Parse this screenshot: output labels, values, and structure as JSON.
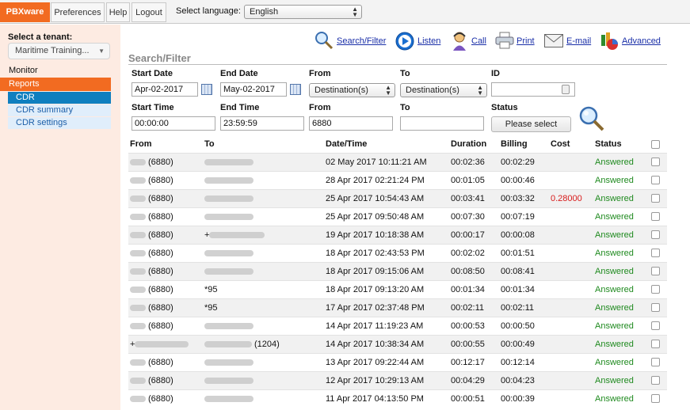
{
  "nav": {
    "logo": "PBXware",
    "preferences": "Preferences",
    "help": "Help",
    "logout": "Logout",
    "language_label": "Select language:",
    "language_value": "English"
  },
  "sidebar": {
    "tenant_label": "Select a tenant:",
    "tenant_value": "Maritime Training...",
    "monitor": "Monitor",
    "reports": "Reports",
    "items": [
      "CDR",
      "CDR summary",
      "CDR settings"
    ]
  },
  "toolbar": {
    "search_filter": "Search/Filter",
    "listen": "Listen",
    "call": "Call",
    "print": "Print",
    "email": "E-mail",
    "advanced": "Advanced"
  },
  "filter": {
    "title": "Search/Filter",
    "start_date_label": "Start Date",
    "start_date": "Apr-02-2017",
    "end_date_label": "End Date",
    "end_date": "May-02-2017",
    "from_label": "From",
    "from_select": "Destination(s)",
    "to_label": "To",
    "to_select": "Destination(s)",
    "id_label": "ID",
    "id_value": "",
    "start_time_label": "Start Time",
    "start_time": "00:00:00",
    "end_time_label": "End Time",
    "end_time": "23:59:59",
    "from2_label": "From",
    "from2_value": "6880",
    "to2_label": "To",
    "to2_value": "",
    "status_label": "Status",
    "status_button": "Please select"
  },
  "table": {
    "headers": [
      "From",
      "To",
      "Date/Time",
      "Duration",
      "Billing",
      "Cost",
      "Status"
    ],
    "rows": [
      {
        "from": "(6880)",
        "to": "",
        "dt": "02 May 2017 10:11:21 AM",
        "dur": "00:02:36",
        "bill": "00:02:29",
        "cost": "",
        "status": "Answered"
      },
      {
        "from": "(6880)",
        "to": "",
        "dt": "28 Apr 2017 02:21:24 PM",
        "dur": "00:01:05",
        "bill": "00:00:46",
        "cost": "",
        "status": "Answered"
      },
      {
        "from": "(6880)",
        "to": "",
        "dt": "25 Apr 2017 10:54:43 AM",
        "dur": "00:03:41",
        "bill": "00:03:32",
        "cost": "0.28000",
        "status": "Answered"
      },
      {
        "from": "(6880)",
        "to": "",
        "dt": "25 Apr 2017 09:50:48 AM",
        "dur": "00:07:30",
        "bill": "00:07:19",
        "cost": "",
        "status": "Answered"
      },
      {
        "from": "(6880)",
        "to": "+",
        "dt": "19 Apr 2017 10:18:38 AM",
        "dur": "00:00:17",
        "bill": "00:00:08",
        "cost": "",
        "status": "Answered"
      },
      {
        "from": "(6880)",
        "to": "",
        "dt": "18 Apr 2017 02:43:53 PM",
        "dur": "00:02:02",
        "bill": "00:01:51",
        "cost": "",
        "status": "Answered"
      },
      {
        "from": "(6880)",
        "to": "",
        "dt": "18 Apr 2017 09:15:06 AM",
        "dur": "00:08:50",
        "bill": "00:08:41",
        "cost": "",
        "status": "Answered"
      },
      {
        "from": "(6880)",
        "to": "*95",
        "dt": "18 Apr 2017 09:13:20 AM",
        "dur": "00:01:34",
        "bill": "00:01:34",
        "cost": "",
        "status": "Answered"
      },
      {
        "from": "(6880)",
        "to": "*95",
        "dt": "17 Apr 2017 02:37:48 PM",
        "dur": "00:02:11",
        "bill": "00:02:11",
        "cost": "",
        "status": "Answered"
      },
      {
        "from": "(6880)",
        "to": "",
        "dt": "14 Apr 2017 11:19:23 AM",
        "dur": "00:00:53",
        "bill": "00:00:50",
        "cost": "",
        "status": "Answered"
      },
      {
        "from": "+",
        "to": "(1204)",
        "dt": "14 Apr 2017 10:38:34 AM",
        "dur": "00:00:55",
        "bill": "00:00:49",
        "cost": "",
        "status": "Answered"
      },
      {
        "from": "(6880)",
        "to": "",
        "dt": "13 Apr 2017 09:22:44 AM",
        "dur": "00:12:17",
        "bill": "00:12:14",
        "cost": "",
        "status": "Answered"
      },
      {
        "from": "(6880)",
        "to": "",
        "dt": "12 Apr 2017 10:29:13 AM",
        "dur": "00:04:29",
        "bill": "00:04:23",
        "cost": "",
        "status": "Answered"
      },
      {
        "from": "(6880)",
        "to": "",
        "dt": "11 Apr 2017 04:13:50 PM",
        "dur": "00:00:51",
        "bill": "00:00:39",
        "cost": "",
        "status": "Answered"
      }
    ]
  }
}
